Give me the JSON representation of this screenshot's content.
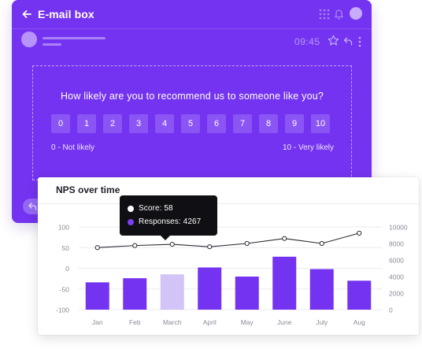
{
  "email": {
    "title": "E-mail box",
    "time": "09:45",
    "survey": {
      "question": "How likely are you to recommend us to someone like you?",
      "scale": [
        "0",
        "1",
        "2",
        "3",
        "4",
        "5",
        "6",
        "7",
        "8",
        "9",
        "10"
      ],
      "low_label": "0 - Not likely",
      "high_label": "10 - Very likely"
    },
    "colors": {
      "background": "#7433f0",
      "button": "#8b54f4"
    }
  },
  "chart_data": {
    "type": "bar",
    "title": "NPS over time",
    "categories": [
      "Jan",
      "Feb",
      "March",
      "April",
      "May",
      "June",
      "July",
      "Aug"
    ],
    "series": [
      {
        "name": "Score",
        "type": "line",
        "axis": "left",
        "values": [
          50,
          55,
          58,
          52,
          60,
          72,
          60,
          85
        ]
      },
      {
        "name": "Responses",
        "type": "bar",
        "axis": "right",
        "values": [
          3300,
          3800,
          4267,
          5100,
          4000,
          6400,
          4900,
          3500
        ]
      }
    ],
    "y_left": {
      "ticks": [
        "100",
        "50",
        "0",
        "-50",
        "-100"
      ],
      "range": [
        -100,
        100
      ]
    },
    "y_right": {
      "ticks": [
        "10000",
        "8000",
        "6000",
        "4000",
        "2000",
        "0"
      ],
      "range": [
        0,
        10000
      ]
    },
    "highlighted_category": "March",
    "tooltip": {
      "score_label": "Score: 58",
      "responses_label": "Responses: 4267"
    },
    "colors": {
      "bar": "#7433f0",
      "bar_highlight": "#d2c4f6",
      "line": "#2b2b33",
      "point_fill": "#ffffff"
    }
  }
}
